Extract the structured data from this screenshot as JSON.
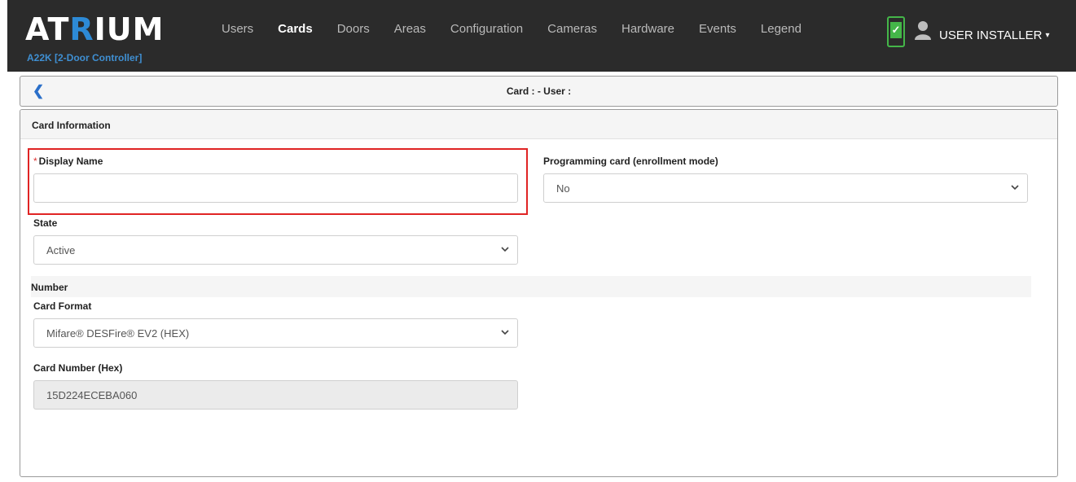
{
  "nav": {
    "logo_a": "A",
    "logo_t": "T",
    "logo_r": "R",
    "logo_rest": "IUM",
    "controller": "A22K [2-Door Controller]",
    "items": [
      {
        "label": "Users",
        "active": false
      },
      {
        "label": "Cards",
        "active": true
      },
      {
        "label": "Doors",
        "active": false
      },
      {
        "label": "Areas",
        "active": false
      },
      {
        "label": "Configuration",
        "active": false
      },
      {
        "label": "Cameras",
        "active": false
      },
      {
        "label": "Hardware",
        "active": false
      },
      {
        "label": "Events",
        "active": false
      },
      {
        "label": "Legend",
        "active": false
      }
    ],
    "user_label": "USER INSTALLER",
    "user_caret": "▾",
    "phone_check": "✓"
  },
  "header": {
    "back_glyph": "❮",
    "title": "Card : - User :"
  },
  "panel": {
    "title": "Card Information"
  },
  "form": {
    "display_name": {
      "required_mark": "*",
      "label": "Display Name",
      "value": ""
    },
    "programming_card": {
      "label": "Programming card (enrollment mode)",
      "value": "No"
    },
    "state": {
      "label": "State",
      "value": "Active"
    },
    "number_section": "Number",
    "card_format": {
      "label": "Card Format",
      "value": "Mifare® DESFire® EV2 (HEX)"
    },
    "card_number": {
      "label": "Card Number (Hex)",
      "value": "15D224ECEBA060"
    }
  },
  "colors": {
    "navbar": "#2b2b2b",
    "accent_blue": "#2d8ad6",
    "highlight_red": "#e02424",
    "status_green": "#44b649"
  }
}
